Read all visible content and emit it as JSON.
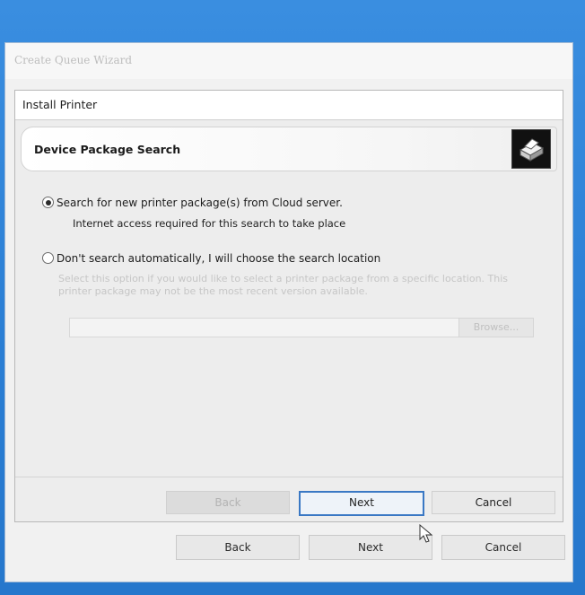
{
  "outer_window": {
    "title": "Create Queue Wizard",
    "footer_buttons": {
      "back": "Back",
      "next": "Next",
      "cancel": "Cancel"
    }
  },
  "dialog": {
    "title": "Install Printer",
    "header": "Device Package Search",
    "header_icon": "printer-icon",
    "option_cloud": {
      "label": "Search for new printer package(s) from Cloud server.",
      "note": "Internet access required for this search to take place",
      "selected": true
    },
    "option_manual": {
      "label": "Don't search automatically, I will choose the search location",
      "description": "Select this option if you would like to select a printer package from a specific location. This printer package may not be the most recent version available.",
      "selected": false
    },
    "path_input": {
      "value": "",
      "placeholder": ""
    },
    "browse_label": "Browse...",
    "buttons": {
      "back": "Back",
      "next": "Next",
      "cancel": "Cancel"
    }
  },
  "colors": {
    "accent": "#3a78c4",
    "desktop": "#2b7fd4"
  }
}
